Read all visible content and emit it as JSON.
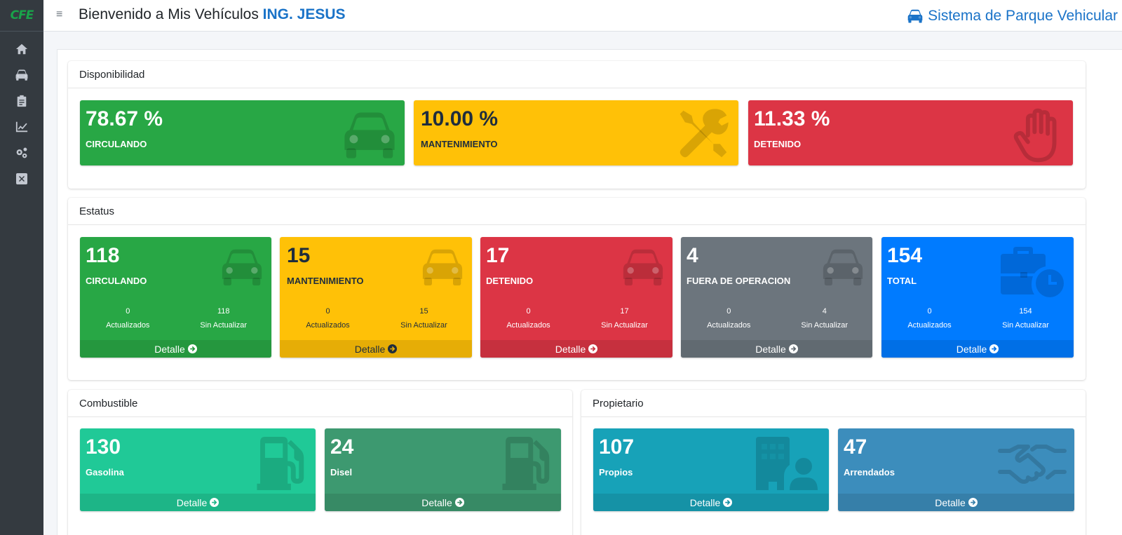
{
  "sidebar": {
    "logo": "CFE",
    "items": [
      {
        "icon": "home-icon"
      },
      {
        "icon": "car-icon"
      },
      {
        "icon": "clipboard-icon"
      },
      {
        "icon": "chart-line-icon"
      },
      {
        "icon": "cogs-icon"
      },
      {
        "icon": "close-box-icon"
      }
    ]
  },
  "header": {
    "menu_icon": "≡",
    "welcome_text": "Bienvenido a Mis Vehículos ",
    "user_name": "ING. JESUS",
    "system_title": "Sistema de Parque Vehicular"
  },
  "disponibilidad": {
    "title": "Disponibilidad",
    "boxes": [
      {
        "value": "78.67 %",
        "label": "CIRCULANDO",
        "color": "#28a745",
        "icon": "car-icon"
      },
      {
        "value": "10.00 %",
        "label": "MANTENIMIENTO",
        "color": "#ffc107",
        "icon": "tools-icon"
      },
      {
        "value": "11.33 %",
        "label": "DETENIDO",
        "color": "#dc3545",
        "icon": "hand-stop-icon"
      }
    ]
  },
  "estatus": {
    "title": "Estatus",
    "boxes": [
      {
        "value": "118",
        "label": "CIRCULANDO",
        "updated": "0",
        "updated_label": "Actualizados",
        "not_updated": "118",
        "not_updated_label": "Sin Actualizar",
        "footer": "Detalle",
        "color": "#28a745",
        "icon": "car-icon"
      },
      {
        "value": "15",
        "label": "MANTENIMIENTO",
        "updated": "0",
        "updated_label": "Actualizados",
        "not_updated": "15",
        "not_updated_label": "Sin Actualizar",
        "footer": "Detalle",
        "color": "#ffc107",
        "icon": "car-icon"
      },
      {
        "value": "17",
        "label": "DETENIDO",
        "updated": "0",
        "updated_label": "Actualizados",
        "not_updated": "17",
        "not_updated_label": "Sin Actualizar",
        "footer": "Detalle",
        "color": "#dc3545",
        "icon": "car-icon"
      },
      {
        "value": "4",
        "label": "FUERA DE OPERACION",
        "updated": "0",
        "updated_label": "Actualizados",
        "not_updated": "4",
        "not_updated_label": "Sin Actualizar",
        "footer": "Detalle",
        "color": "#6c757d",
        "icon": "car-icon"
      },
      {
        "value": "154",
        "label": "TOTAL",
        "updated": "0",
        "updated_label": "Actualizados",
        "not_updated": "154",
        "not_updated_label": "Sin Actualizar",
        "footer": "Detalle",
        "color": "#007bff",
        "icon": "business-time-icon"
      }
    ]
  },
  "combustible": {
    "title": "Combustible",
    "boxes": [
      {
        "value": "130",
        "label": "Gasolina",
        "footer": "Detalle",
        "color": "#20c997",
        "icon": "gas-pump-icon"
      },
      {
        "value": "24",
        "label": "Disel",
        "footer": "Detalle",
        "color": "#3d9970",
        "icon": "gas-pump-icon"
      }
    ]
  },
  "propietario": {
    "title": "Propietario",
    "boxes": [
      {
        "value": "107",
        "label": "Propios",
        "footer": "Detalle",
        "color": "#17a2b8",
        "icon": "building-user-icon"
      },
      {
        "value": "47",
        "label": "Arrendados",
        "footer": "Detalle",
        "color": "#3c8dbc",
        "icon": "handshake-icon"
      }
    ]
  }
}
